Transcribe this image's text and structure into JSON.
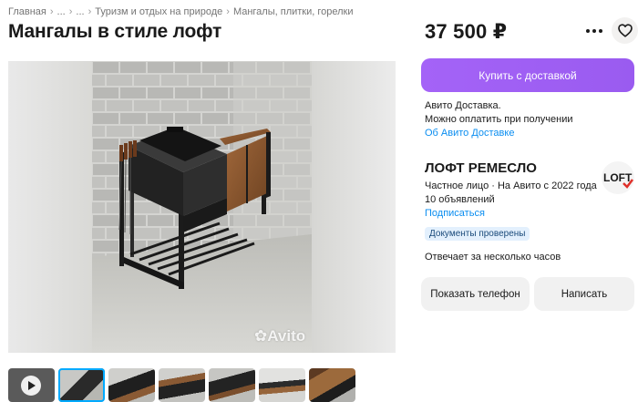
{
  "breadcrumb": {
    "items": [
      "Главная",
      "...",
      "...",
      "Туризм и отдых на природе",
      "Мангалы, плитки, горелки"
    ],
    "separator": "›"
  },
  "listing": {
    "title": "Мангалы в стиле лофт",
    "price": "37 500 ₽"
  },
  "gallery": {
    "watermark": "Avito",
    "thumbnail_count": 7,
    "active_thumbnail": 1
  },
  "actions": {
    "buy_label": "Купить с доставкой",
    "phone_label": "Показать телефон",
    "message_label": "Написать"
  },
  "delivery": {
    "line1": "Авито Доставка.",
    "line2": "Можно оплатить при получении",
    "link": "Об Авито Доставке"
  },
  "seller": {
    "name": "ЛОФТ РЕМЕСЛО",
    "type_line": "Частное лицо · На Авито с 2022 года",
    "listings": "10 объявлений",
    "subscribe": "Подписаться",
    "logo_text": "LOFT",
    "badge": "Документы проверены",
    "response": "Отвечает за несколько часов"
  },
  "colors": {
    "accent_purple": "#9d5cf5",
    "link_blue": "#0a8df0",
    "badge_bg": "#e3f0fd",
    "button_gray": "#f1f1f1",
    "logo_red": "#e0302a"
  },
  "icons": {
    "more": "more-dots-icon",
    "favorite": "heart-icon",
    "play": "play-icon",
    "watermark": "avito-logo-icon"
  }
}
